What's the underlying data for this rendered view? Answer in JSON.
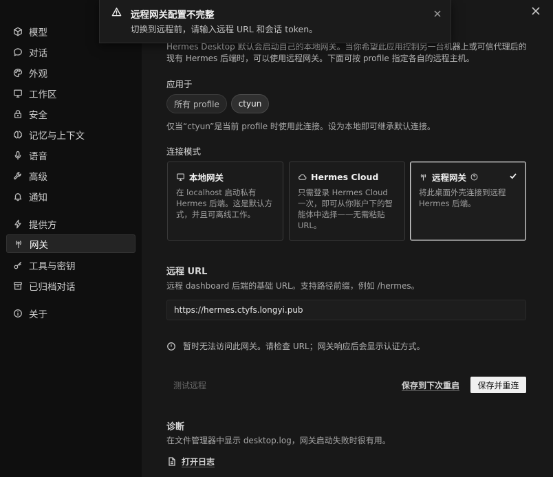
{
  "toast": {
    "title": "远程网关配置不完整",
    "message": "切换到远程前，请输入远程 URL 和会话 token。"
  },
  "sidebar": {
    "items": [
      {
        "label": "模型",
        "icon": "cube-icon"
      },
      {
        "label": "对话",
        "icon": "chat-bubble-icon"
      },
      {
        "label": "外观",
        "icon": "palette-icon"
      },
      {
        "label": "工作区",
        "icon": "monitor-icon"
      },
      {
        "label": "安全",
        "icon": "lock-icon"
      },
      {
        "label": "记忆与上下文",
        "icon": "brain-icon"
      },
      {
        "label": "语音",
        "icon": "microphone-icon"
      },
      {
        "label": "高级",
        "icon": "wrench-icon"
      },
      {
        "label": "通知",
        "icon": "bell-icon"
      },
      {
        "label": "提供方",
        "icon": "lightning-icon"
      },
      {
        "label": "网关",
        "icon": "antenna-icon"
      },
      {
        "label": "工具与密钥",
        "icon": "key-icon"
      },
      {
        "label": "已归档对话",
        "icon": "archive-icon"
      },
      {
        "label": "关于",
        "icon": "info-icon"
      }
    ],
    "active": "网关"
  },
  "main": {
    "intro_line1": "Hermes Desktop 默认会启动自己的本地网关。当你希望此应用控制另一台机器上或可信代理后的",
    "intro_line2": "现有 Hermes 后端时，可以使用远程网关。下面可按 profile 指定各自的远程主机。",
    "apply_to_label": "应用于",
    "profile_chips": [
      "所有 profile",
      "ctyun"
    ],
    "selected_profile": "ctyun",
    "apply_hint": "仅当“ctyun”是当前 profile 时使用此连接。设为本地即可继承默认连接。",
    "mode_label": "连接模式",
    "modes": [
      {
        "title": "本地网关",
        "icon": "monitor-icon",
        "desc": "在 localhost 启动私有 Hermes 后端。这是默认方式，并且可离线工作。"
      },
      {
        "title": "Hermes Cloud",
        "icon": "cloud-icon",
        "desc": "只需登录 Hermes Cloud 一次，即可从你账户下的智能体中选择——无需粘贴 URL。"
      },
      {
        "title": "远程网关",
        "icon": "antenna-icon",
        "desc": "将此桌面外壳连接到远程 Hermes 后端。"
      }
    ],
    "selected_mode": "远程网关",
    "remote_url_label": "远程 URL",
    "remote_url_hint": "远程 dashboard 后端的基础 URL。支持路径前缀，例如 /hermes。",
    "remote_url_value": "https://hermes.ctyfs.longyi.pub",
    "warning_text": "暂时无法访问此网关。请检查 URL；网关响应后会显示认证方式。",
    "test_button": "测试远程",
    "save_later_button": "保存到下次重启",
    "save_restart_button": "保存并重连",
    "diagnostics_label": "诊断",
    "diagnostics_hint": "在文件管理器中显示 desktop.log，网关启动失败时很有用。",
    "open_log_button": "打开日志"
  }
}
